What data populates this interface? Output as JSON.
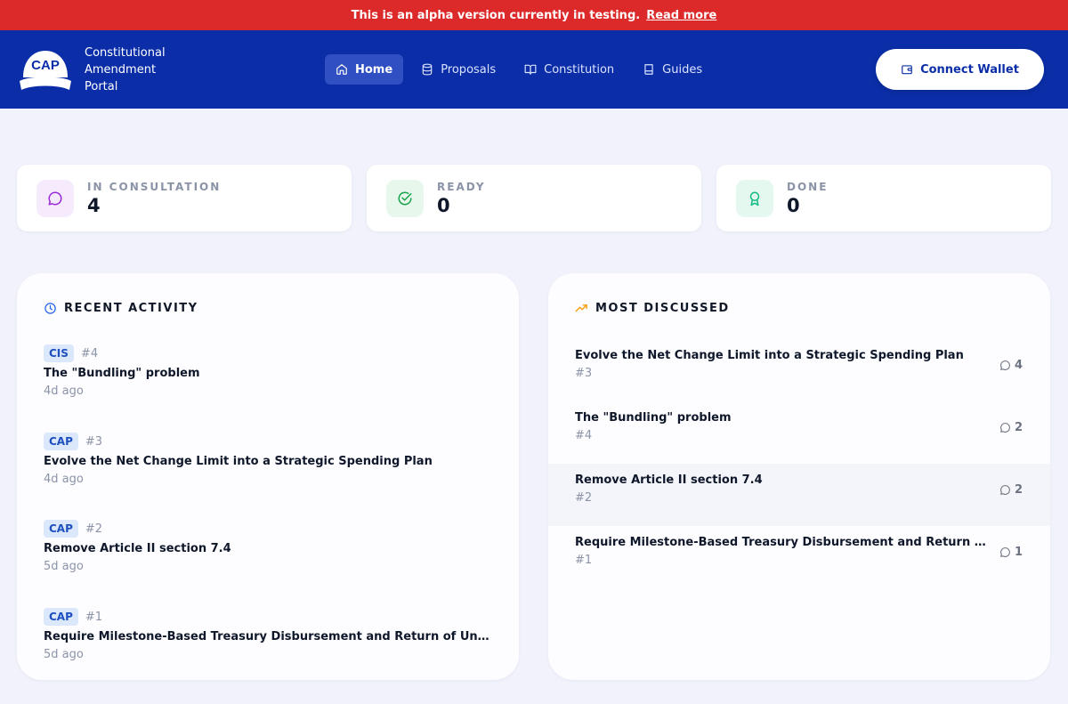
{
  "banner": {
    "text": "This is an alpha version currently in testing.",
    "link": "Read more"
  },
  "brand": {
    "logo_text": "CAP",
    "name": "Constitutional Amendment Portal"
  },
  "nav": [
    {
      "label": "Home",
      "icon": "home-icon",
      "active": true
    },
    {
      "label": "Proposals",
      "icon": "database-icon",
      "active": false
    },
    {
      "label": "Constitution",
      "icon": "book-open-icon",
      "active": false
    },
    {
      "label": "Guides",
      "icon": "book-icon",
      "active": false
    }
  ],
  "connect_wallet": "Connect Wallet",
  "stats": [
    {
      "label": "IN CONSULTATION",
      "value": "4",
      "icon": "message-icon",
      "color": "#9b2bd6"
    },
    {
      "label": "READY",
      "value": "0",
      "icon": "check-circle-icon",
      "color": "#16a34a"
    },
    {
      "label": "DONE",
      "value": "0",
      "icon": "award-icon",
      "color": "#10b981"
    }
  ],
  "recent_activity": {
    "title": "RECENT ACTIVITY",
    "items": [
      {
        "tag": "CIS",
        "num": "#4",
        "title": "The \"Bundling\" problem",
        "time": "4d ago"
      },
      {
        "tag": "CAP",
        "num": "#3",
        "title": "Evolve the Net Change Limit into a Strategic Spending Plan",
        "time": "4d ago"
      },
      {
        "tag": "CAP",
        "num": "#2",
        "title": "Remove Article II section 7.4",
        "time": "5d ago"
      },
      {
        "tag": "CAP",
        "num": "#1",
        "title": "Require Milestone-Based Treasury Disbursement and Return of Undistributed Funds",
        "time": "5d ago"
      }
    ]
  },
  "most_discussed": {
    "title": "MOST DISCUSSED",
    "items": [
      {
        "title": "Evolve the Net Change Limit into a Strategic Spending Plan",
        "num": "#3",
        "comments": "4"
      },
      {
        "title": "The \"Bundling\" problem",
        "num": "#4",
        "comments": "2"
      },
      {
        "title": "Remove Article II section 7.4",
        "num": "#2",
        "comments": "2"
      },
      {
        "title": "Require Milestone-Based Treasury Disbursement and Return of Undistributed Funds",
        "num": "#1",
        "comments": "1"
      }
    ]
  }
}
